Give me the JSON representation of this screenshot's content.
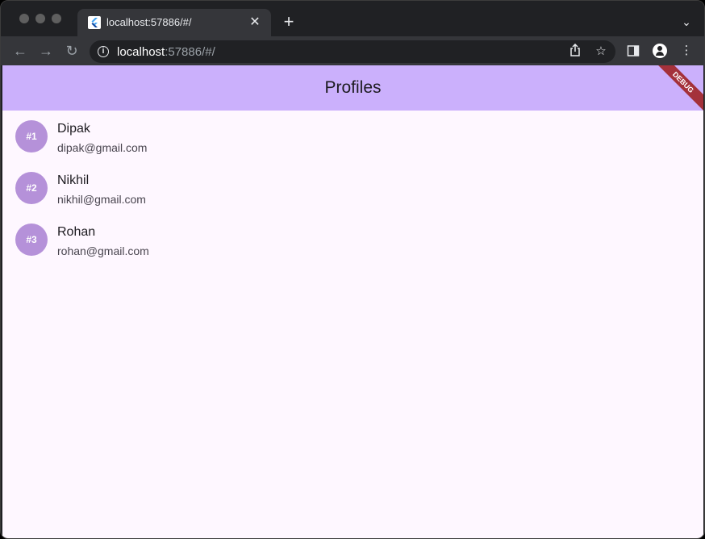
{
  "browser": {
    "tab_title": "localhost:57886/#/",
    "url_host": "localhost",
    "url_rest": ":57886/#/"
  },
  "app": {
    "title": "Profiles",
    "debug_label": "DEBUG",
    "colors": {
      "appbar": "#cbb0fc",
      "avatar": "#b591d9",
      "background": "#fef7ff",
      "debug_banner": "#a4313b"
    },
    "profiles": [
      {
        "badge": "#1",
        "name": "Dipak",
        "email": "dipak@gmail.com"
      },
      {
        "badge": "#2",
        "name": "Nikhil",
        "email": "nikhil@gmail.com"
      },
      {
        "badge": "#3",
        "name": "Rohan",
        "email": "rohan@gmail.com"
      }
    ]
  }
}
